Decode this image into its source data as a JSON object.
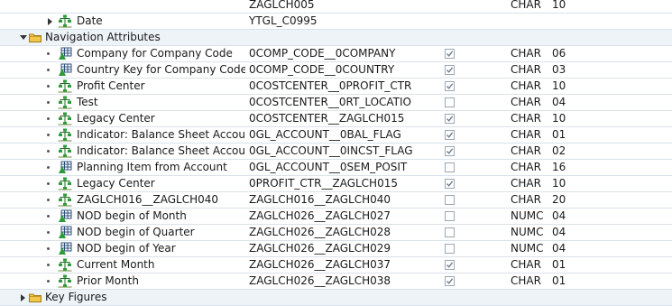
{
  "rows": [
    {
      "kind": "partial",
      "c1": "",
      "c2": "ZAGLCH005",
      "c4": "CHAR",
      "c5": "10"
    },
    {
      "kind": "item",
      "expander": "right",
      "icon": "hierarchy-char-icon",
      "label": "Date",
      "tech": "YTGL_C0995",
      "checked": null,
      "type": "",
      "len": ""
    },
    {
      "kind": "folder",
      "expander": "down",
      "icon": "folder-icon",
      "label": "Navigation Attributes"
    },
    {
      "kind": "item",
      "expander": "bullet",
      "icon": "grid-char-icon",
      "label": "Company for Company Code",
      "tech": "0COMP_CODE__0COMPANY",
      "checked": true,
      "type": "CHAR",
      "len": "06"
    },
    {
      "kind": "item",
      "expander": "bullet",
      "icon": "grid-char-icon",
      "label": "Country Key for Company Code",
      "tech": "0COMP_CODE__0COUNTRY",
      "checked": true,
      "type": "CHAR",
      "len": "03"
    },
    {
      "kind": "item",
      "expander": "bullet",
      "icon": "hierarchy-char-icon",
      "label": "Profit Center",
      "tech": "0COSTCENTER__0PROFIT_CTR",
      "checked": true,
      "type": "CHAR",
      "len": "10"
    },
    {
      "kind": "item",
      "expander": "bullet",
      "icon": "hierarchy-char-icon",
      "label": "Test",
      "tech": "0COSTCENTER__0RT_LOCATIO",
      "checked": false,
      "type": "CHAR",
      "len": "04"
    },
    {
      "kind": "item",
      "expander": "bullet",
      "icon": "hierarchy-char-icon",
      "label": "Legacy Center",
      "tech": "0COSTCENTER__ZAGLCH015",
      "checked": true,
      "type": "CHAR",
      "len": "10"
    },
    {
      "kind": "item",
      "expander": "bullet",
      "icon": "hierarchy-char-icon",
      "label": "Indicator: Balance Sheet Account",
      "tech": "0GL_ACCOUNT__0BAL_FLAG",
      "checked": true,
      "type": "CHAR",
      "len": "01"
    },
    {
      "kind": "item",
      "expander": "bullet",
      "icon": "hierarchy-char-icon",
      "label": "Indicator: Balance Sheet Account",
      "tech": "0GL_ACCOUNT__0INCST_FLAG",
      "checked": true,
      "type": "CHAR",
      "len": "02"
    },
    {
      "kind": "item",
      "expander": "bullet",
      "icon": "grid-char-icon",
      "label": "Planning Item from Account",
      "tech": "0GL_ACCOUNT__0SEM_POSIT",
      "checked": false,
      "type": "CHAR",
      "len": "16"
    },
    {
      "kind": "item",
      "expander": "bullet",
      "icon": "hierarchy-char-icon",
      "label": "Legacy Center",
      "tech": "0PROFIT_CTR__ZAGLCH015",
      "checked": true,
      "type": "CHAR",
      "len": "10"
    },
    {
      "kind": "item",
      "expander": "bullet",
      "icon": "hierarchy-char-icon",
      "label": "ZAGLCH016__ZAGLCH040",
      "tech": "ZAGLCH016__ZAGLCH040",
      "checked": false,
      "type": "CHAR",
      "len": "20"
    },
    {
      "kind": "item",
      "expander": "bullet",
      "icon": "grid-char-icon",
      "label": "NOD begin of Month",
      "tech": "ZAGLCH026__ZAGLCH027",
      "checked": false,
      "type": "NUMC",
      "len": "04"
    },
    {
      "kind": "item",
      "expander": "bullet",
      "icon": "grid-char-icon",
      "label": "NOD begin of Quarter",
      "tech": "ZAGLCH026__ZAGLCH028",
      "checked": false,
      "type": "NUMC",
      "len": "04"
    },
    {
      "kind": "item",
      "expander": "bullet",
      "icon": "grid-char-icon",
      "label": "NOD begin of Year",
      "tech": "ZAGLCH026__ZAGLCH029",
      "checked": false,
      "type": "NUMC",
      "len": "04"
    },
    {
      "kind": "item",
      "expander": "bullet",
      "icon": "hierarchy-char-icon",
      "label": "Current Month",
      "tech": "ZAGLCH026__ZAGLCH037",
      "checked": true,
      "type": "CHAR",
      "len": "01"
    },
    {
      "kind": "item",
      "expander": "bullet",
      "icon": "hierarchy-char-icon",
      "label": "Prior Month",
      "tech": "ZAGLCH026__ZAGLCH038",
      "checked": true,
      "type": "CHAR",
      "len": "01"
    },
    {
      "kind": "folder",
      "expander": "right",
      "icon": "folder-icon",
      "label": "Key Figures"
    }
  ],
  "colors": {
    "folder_row_bg": "#eef3f8",
    "grid": "#d9e2ea",
    "check": "#6f7f90"
  }
}
